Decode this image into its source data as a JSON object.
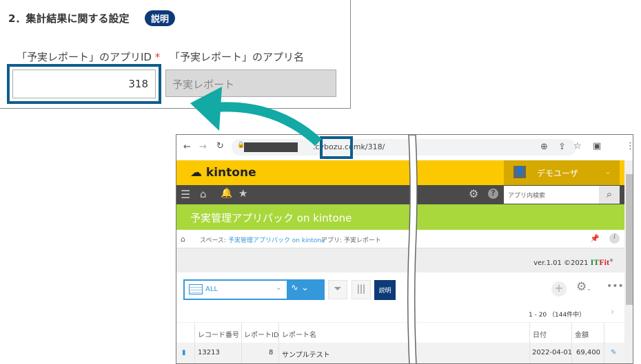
{
  "settings": {
    "title": "2．集計結果に関する設定",
    "help_badge": "説明",
    "app_id_label": "「予実レポート」のアプリID",
    "required_mark": "*",
    "app_name_label": "「予実レポート」のアプリ名",
    "app_id_value": "318",
    "app_name_value": "予実レポート"
  },
  "browser": {
    "url_domain": ".cybozu.com",
    "url_path": "k/318/"
  },
  "kintone": {
    "logo": "kintone",
    "user": "デモユーザ",
    "search_placeholder": "アプリ内検索",
    "app_title": "予実管理アプリパック on kintone",
    "breadcrumb": {
      "space_prefix": "スペース: ",
      "space": "予実管理アプリパック on kintone",
      "app": "アプリ: 予実レポート"
    },
    "version": "ver.1.01 ©2021 ",
    "brand_it": "IT",
    "brand_fit": "Fit",
    "brand_reg": "®",
    "view": "ALL",
    "desc_button": "説明",
    "pagination": "1 - 20 （144件中）",
    "columns": [
      "レコード番号",
      "レポートID",
      "レポート名",
      "日付",
      "金額"
    ],
    "rows": [
      {
        "record_no": "13213",
        "report_id": "8",
        "report_name": "サンプルテスト",
        "date": "2022-04-01",
        "amount": "69,400"
      }
    ]
  },
  "colors": {
    "arrow": "#13a9a5",
    "highlight": "#0e5e8c",
    "header": "#fcc800",
    "green": "#a9d83c"
  }
}
